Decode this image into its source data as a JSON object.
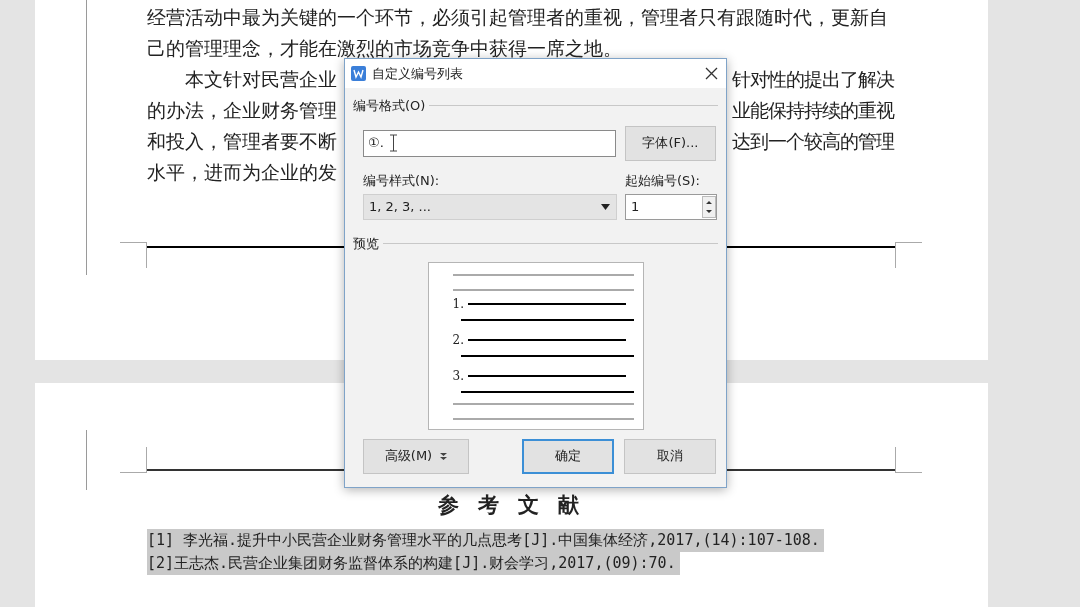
{
  "document": {
    "page_1_lines": [
      {
        "indent": false,
        "left": "经营活动中最为关键的一个环节，必须引起管理者的重视，管理者只有跟随时代，更新自"
      },
      {
        "indent": false,
        "left": "己的管理理念，才能在激烈的市场竞争中获得一席之地。"
      },
      {
        "indent": true,
        "left": "本文针对民营企业",
        "right": "针对性的提出了解决"
      },
      {
        "indent": false,
        "left": "的办法，企业财务管理",
        "right": "业能保持持续的重视"
      },
      {
        "indent": false,
        "left": "和投入，管理者要不断",
        "right": "达到一个较高的管理"
      },
      {
        "indent": false,
        "left": "水平，进而为企业的发"
      }
    ],
    "references": {
      "title": "参 考 文 献",
      "items": [
        {
          "text": "[1] 李光福.提升中小民营企业财务管理水平的几点思考[J].中国集体经济,2017,(14):107-108.",
          "highlighted": true
        },
        {
          "text": "[2]王志杰.民营企业集团财务监督体系的构建[J].财会学习,2017,(09):70.",
          "highlighted": true
        }
      ]
    }
  },
  "dialog": {
    "title": "自定义编号列表",
    "format_label": "编号格式(O)",
    "format_value": "①.",
    "font_button": "字体(F)...",
    "style_label": "编号样式(N):",
    "style_value": "1, 2, 3, ...",
    "start_label": "起始编号(S):",
    "start_value": "1",
    "preview_label": "预览",
    "preview_numbers": [
      "1.",
      "2.",
      "3."
    ],
    "buttons": [
      {
        "kind": "menu",
        "label": "高级(M)",
        "focused": false
      },
      {
        "kind": "plain",
        "label": "确定",
        "focused": true
      },
      {
        "kind": "plain",
        "label": "取消",
        "focused": false
      }
    ]
  }
}
